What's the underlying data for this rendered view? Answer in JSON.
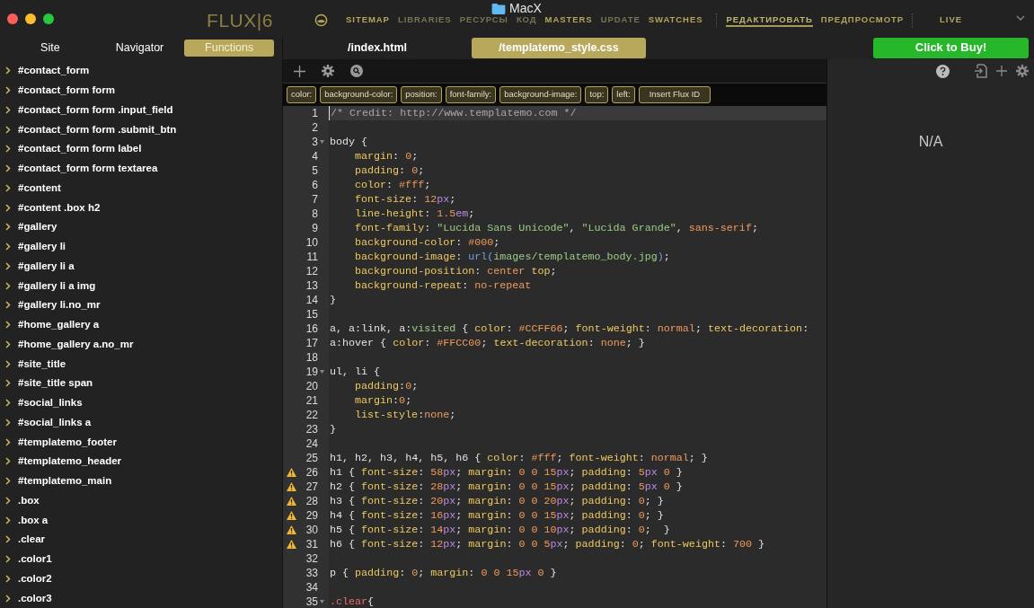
{
  "window": {
    "title": "MacX"
  },
  "logo": "FLUX|6",
  "nav": [
    {
      "label": "SITEMAP",
      "selected": false,
      "dim": false
    },
    {
      "label": "LIBRARIES",
      "selected": false,
      "dim": true
    },
    {
      "label": "РЕСУРСЫ",
      "selected": false,
      "dim": true
    },
    {
      "label": "КОД",
      "selected": false,
      "dim": true
    },
    {
      "label": "MASTERS",
      "selected": false,
      "dim": false
    },
    {
      "label": "UPDATE",
      "selected": false,
      "dim": true
    },
    {
      "label": "SWATCHES",
      "selected": false,
      "dim": false
    },
    {
      "label": "РЕДАКТИРОВАТЬ",
      "selected": true,
      "dim": false
    },
    {
      "label": "ПРЕДПРОСМОТР",
      "selected": false,
      "dim": false
    },
    {
      "label": "LIVE",
      "selected": false,
      "dim": false
    }
  ],
  "sidebar_tabs": [
    {
      "label": "Site",
      "selected": false
    },
    {
      "label": "Navigator",
      "selected": false
    },
    {
      "label": "Functions",
      "selected": true
    }
  ],
  "file_tabs": [
    {
      "label": "/index.html",
      "selected": false
    },
    {
      "label": "/templatemo_style.css",
      "selected": true
    }
  ],
  "buy_button": "Click to Buy!",
  "sidebar": {
    "items": [
      "#contact_form",
      "#contact_form form",
      "#contact_form form .input_field",
      "#contact_form form .submit_btn",
      "#contact_form form label",
      "#contact_form form textarea",
      "#content",
      "#content .box h2",
      "#gallery",
      "#gallery li",
      "#gallery li a",
      "#gallery li a img",
      "#gallery li.no_mr",
      "#home_gallery a",
      "#home_gallery a.no_mr",
      "#site_title",
      "#site_title span",
      "#social_links",
      "#social_links a",
      "#templatemo_footer",
      "#templatemo_header",
      "#templatemo_main",
      ".box",
      ".box a",
      ".clear",
      ".color1",
      ".color2",
      ".color3"
    ]
  },
  "chips": [
    "color:",
    "background-color:",
    "position:",
    "font-family:",
    "background-image:",
    "top:",
    "left:",
    "Insert Flux ID"
  ],
  "code_lines": [
    {
      "n": "1",
      "selected": true,
      "warning": false,
      "fold": false,
      "indent": false,
      "tokens": [
        {
          "kind": "comment",
          "text": "/* Credit: http://www.templatemo.com */"
        }
      ]
    },
    {
      "n": "2",
      "selected": false,
      "warning": false,
      "fold": false
    },
    {
      "n": "3",
      "selected": false,
      "warning": false,
      "fold": true,
      "indent": false,
      "tokens": [
        {
          "kind": "selector",
          "text": "body"
        },
        {
          "kind": "plain",
          "text": " {"
        }
      ]
    },
    {
      "n": "4",
      "selected": false,
      "warning": false,
      "fold": false,
      "indent": true,
      "tokens": [
        {
          "kind": "prop",
          "text": "margin"
        },
        {
          "kind": "plain",
          "text": ": "
        },
        {
          "kind": "num",
          "text": "0"
        },
        {
          "kind": "plain",
          "text": ";"
        }
      ]
    },
    {
      "n": "5",
      "selected": false,
      "warning": false,
      "fold": false,
      "indent": true,
      "tokens": [
        {
          "kind": "prop",
          "text": "padding"
        },
        {
          "kind": "plain",
          "text": ": "
        },
        {
          "kind": "num",
          "text": "0"
        },
        {
          "kind": "plain",
          "text": ";"
        }
      ]
    },
    {
      "n": "6",
      "selected": false,
      "warning": false,
      "fold": false,
      "indent": true,
      "tokens": [
        {
          "kind": "prop",
          "text": "color"
        },
        {
          "kind": "plain",
          "text": ": "
        },
        {
          "kind": "num",
          "text": "#fff"
        },
        {
          "kind": "plain",
          "text": ";"
        }
      ]
    },
    {
      "n": "7",
      "selected": false,
      "warning": false,
      "fold": false,
      "indent": true,
      "tokens": [
        {
          "kind": "prop",
          "text": "font-size"
        },
        {
          "kind": "plain",
          "text": ": "
        },
        {
          "kind": "num",
          "text": "12"
        },
        {
          "kind": "unit",
          "text": "px"
        },
        {
          "kind": "plain",
          "text": ";"
        }
      ]
    },
    {
      "n": "8",
      "selected": false,
      "warning": false,
      "fold": false,
      "indent": true,
      "tokens": [
        {
          "kind": "prop",
          "text": "line-height"
        },
        {
          "kind": "plain",
          "text": ": "
        },
        {
          "kind": "num",
          "text": "1.5"
        },
        {
          "kind": "unit",
          "text": "em"
        },
        {
          "kind": "plain",
          "text": ";"
        }
      ]
    },
    {
      "n": "9",
      "selected": false,
      "warning": false,
      "fold": false,
      "indent": true,
      "tokens": [
        {
          "kind": "prop",
          "text": "font-family"
        },
        {
          "kind": "plain",
          "text": ": "
        },
        {
          "kind": "string",
          "text": "\"Lucida Sans Unicode\""
        },
        {
          "kind": "plain",
          "text": ", "
        },
        {
          "kind": "string",
          "text": "\"Lucida Grande\""
        },
        {
          "kind": "plain",
          "text": ", "
        },
        {
          "kind": "keyword",
          "text": "sans-serif"
        },
        {
          "kind": "plain",
          "text": ";"
        }
      ]
    },
    {
      "n": "10",
      "selected": false,
      "warning": false,
      "fold": false,
      "indent": true,
      "tokens": [
        {
          "kind": "prop",
          "text": "background-color"
        },
        {
          "kind": "plain",
          "text": ": "
        },
        {
          "kind": "num",
          "text": "#000"
        },
        {
          "kind": "plain",
          "text": ";"
        }
      ]
    },
    {
      "n": "11",
      "selected": false,
      "warning": false,
      "fold": false,
      "indent": true,
      "tokens": [
        {
          "kind": "prop",
          "text": "background-image"
        },
        {
          "kind": "plain",
          "text": ": "
        },
        {
          "kind": "func",
          "text": "url("
        },
        {
          "kind": "string",
          "text": "images/templatemo_body.jpg"
        },
        {
          "kind": "func",
          "text": ")"
        },
        {
          "kind": "plain",
          "text": ";"
        }
      ]
    },
    {
      "n": "12",
      "selected": false,
      "warning": false,
      "fold": false,
      "indent": true,
      "tokens": [
        {
          "kind": "prop",
          "text": "background-position"
        },
        {
          "kind": "plain",
          "text": ": "
        },
        {
          "kind": "keyword",
          "text": "center"
        },
        {
          "kind": "prop",
          "text": " top"
        },
        {
          "kind": "plain",
          "text": ";"
        }
      ]
    },
    {
      "n": "13",
      "selected": false,
      "warning": false,
      "fold": false,
      "indent": true,
      "tokens": [
        {
          "kind": "prop",
          "text": "background-repeat"
        },
        {
          "kind": "plain",
          "text": ": "
        },
        {
          "kind": "keyword",
          "text": "no-repeat"
        }
      ]
    },
    {
      "n": "14",
      "selected": false,
      "warning": false,
      "fold": false,
      "indent": false,
      "tokens": [
        {
          "kind": "plain",
          "text": "}"
        }
      ]
    },
    {
      "n": "15",
      "selected": false,
      "warning": false,
      "fold": false
    },
    {
      "n": "16",
      "selected": false,
      "warning": false,
      "fold": false,
      "indent": false,
      "tokens": [
        {
          "kind": "selector",
          "text": "a, a:link, a:"
        },
        {
          "kind": "pseudo",
          "text": "visited"
        },
        {
          "kind": "plain",
          "text": " { "
        },
        {
          "kind": "prop",
          "text": "color"
        },
        {
          "kind": "plain",
          "text": ": "
        },
        {
          "kind": "num",
          "text": "#CCFF66"
        },
        {
          "kind": "plain",
          "text": "; "
        },
        {
          "kind": "prop",
          "text": "font-weight"
        },
        {
          "kind": "plain",
          "text": ": "
        },
        {
          "kind": "keyword",
          "text": "normal"
        },
        {
          "kind": "plain",
          "text": "; "
        },
        {
          "kind": "prop",
          "text": "text-decoration"
        },
        {
          "kind": "plain",
          "text": ":"
        }
      ]
    },
    {
      "n": "17",
      "selected": false,
      "warning": false,
      "fold": false,
      "indent": false,
      "tokens": [
        {
          "kind": "selector",
          "text": "a:hover"
        },
        {
          "kind": "plain",
          "text": " { "
        },
        {
          "kind": "prop",
          "text": "color"
        },
        {
          "kind": "plain",
          "text": ": "
        },
        {
          "kind": "num",
          "text": "#FFCC00"
        },
        {
          "kind": "plain",
          "text": "; "
        },
        {
          "kind": "prop",
          "text": "text-decoration"
        },
        {
          "kind": "plain",
          "text": ": "
        },
        {
          "kind": "keyword",
          "text": "none"
        },
        {
          "kind": "plain",
          "text": "; }"
        }
      ]
    },
    {
      "n": "18",
      "selected": false,
      "warning": false,
      "fold": false
    },
    {
      "n": "19",
      "selected": false,
      "warning": false,
      "fold": true,
      "indent": false,
      "tokens": [
        {
          "kind": "selector",
          "text": "ul, li"
        },
        {
          "kind": "plain",
          "text": " {"
        }
      ]
    },
    {
      "n": "20",
      "selected": false,
      "warning": false,
      "fold": false,
      "indent": true,
      "tokens": [
        {
          "kind": "prop",
          "text": "padding"
        },
        {
          "kind": "plain",
          "text": ":"
        },
        {
          "kind": "num",
          "text": "0"
        },
        {
          "kind": "plain",
          "text": ";"
        }
      ]
    },
    {
      "n": "21",
      "selected": false,
      "warning": false,
      "fold": false,
      "indent": true,
      "tokens": [
        {
          "kind": "prop",
          "text": "margin"
        },
        {
          "kind": "plain",
          "text": ":"
        },
        {
          "kind": "num",
          "text": "0"
        },
        {
          "kind": "plain",
          "text": ";"
        }
      ]
    },
    {
      "n": "22",
      "selected": false,
      "warning": false,
      "fold": false,
      "indent": true,
      "tokens": [
        {
          "kind": "prop",
          "text": "list-style"
        },
        {
          "kind": "plain",
          "text": ":"
        },
        {
          "kind": "keyword",
          "text": "none"
        },
        {
          "kind": "plain",
          "text": ";"
        }
      ]
    },
    {
      "n": "23",
      "selected": false,
      "warning": false,
      "fold": false,
      "indent": false,
      "tokens": [
        {
          "kind": "plain",
          "text": "}"
        }
      ]
    },
    {
      "n": "24",
      "selected": false,
      "warning": false,
      "fold": false
    },
    {
      "n": "25",
      "selected": false,
      "warning": false,
      "fold": false,
      "indent": false,
      "tokens": [
        {
          "kind": "selector",
          "text": "h1, h2, h3, h4, h5, h6"
        },
        {
          "kind": "plain",
          "text": " { "
        },
        {
          "kind": "prop",
          "text": "color"
        },
        {
          "kind": "plain",
          "text": ": "
        },
        {
          "kind": "num",
          "text": "#fff"
        },
        {
          "kind": "plain",
          "text": "; "
        },
        {
          "kind": "prop",
          "text": "font-weight"
        },
        {
          "kind": "plain",
          "text": ": "
        },
        {
          "kind": "keyword",
          "text": "normal"
        },
        {
          "kind": "plain",
          "text": "; }"
        }
      ]
    },
    {
      "n": "26",
      "selected": false,
      "warning": true,
      "fold": false,
      "indent": false,
      "tokens": [
        {
          "kind": "selector",
          "text": "h1"
        },
        {
          "kind": "plain",
          "text": " { "
        },
        {
          "kind": "prop",
          "text": "font-size"
        },
        {
          "kind": "plain",
          "text": ": "
        },
        {
          "kind": "num",
          "text": "58"
        },
        {
          "kind": "unit",
          "text": "px"
        },
        {
          "kind": "plain",
          "text": "; "
        },
        {
          "kind": "prop",
          "text": "margin"
        },
        {
          "kind": "plain",
          "text": ": "
        },
        {
          "kind": "num",
          "text": "0 0 15"
        },
        {
          "kind": "unit",
          "text": "px"
        },
        {
          "kind": "plain",
          "text": "; "
        },
        {
          "kind": "prop",
          "text": "padding"
        },
        {
          "kind": "plain",
          "text": ": "
        },
        {
          "kind": "num",
          "text": "5"
        },
        {
          "kind": "unit",
          "text": "px"
        },
        {
          "kind": "num",
          "text": " 0"
        },
        {
          "kind": "plain",
          "text": " }"
        }
      ]
    },
    {
      "n": "27",
      "selected": false,
      "warning": true,
      "fold": false,
      "indent": false,
      "tokens": [
        {
          "kind": "selector",
          "text": "h2"
        },
        {
          "kind": "plain",
          "text": " { "
        },
        {
          "kind": "prop",
          "text": "font-size"
        },
        {
          "kind": "plain",
          "text": ": "
        },
        {
          "kind": "num",
          "text": "28"
        },
        {
          "kind": "unit",
          "text": "px"
        },
        {
          "kind": "plain",
          "text": "; "
        },
        {
          "kind": "prop",
          "text": "margin"
        },
        {
          "kind": "plain",
          "text": ": "
        },
        {
          "kind": "num",
          "text": "0 0 15"
        },
        {
          "kind": "unit",
          "text": "px"
        },
        {
          "kind": "plain",
          "text": "; "
        },
        {
          "kind": "prop",
          "text": "padding"
        },
        {
          "kind": "plain",
          "text": ": "
        },
        {
          "kind": "num",
          "text": "5"
        },
        {
          "kind": "unit",
          "text": "px"
        },
        {
          "kind": "num",
          "text": " 0"
        },
        {
          "kind": "plain",
          "text": " }"
        }
      ]
    },
    {
      "n": "28",
      "selected": false,
      "warning": true,
      "fold": false,
      "indent": false,
      "tokens": [
        {
          "kind": "selector",
          "text": "h3"
        },
        {
          "kind": "plain",
          "text": " { "
        },
        {
          "kind": "prop",
          "text": "font-size"
        },
        {
          "kind": "plain",
          "text": ": "
        },
        {
          "kind": "num",
          "text": "20"
        },
        {
          "kind": "unit",
          "text": "px"
        },
        {
          "kind": "plain",
          "text": "; "
        },
        {
          "kind": "prop",
          "text": "margin"
        },
        {
          "kind": "plain",
          "text": ": "
        },
        {
          "kind": "num",
          "text": "0 0 20"
        },
        {
          "kind": "unit",
          "text": "px"
        },
        {
          "kind": "plain",
          "text": "; "
        },
        {
          "kind": "prop",
          "text": "padding"
        },
        {
          "kind": "plain",
          "text": ": "
        },
        {
          "kind": "num",
          "text": "0"
        },
        {
          "kind": "plain",
          "text": "; }"
        }
      ]
    },
    {
      "n": "29",
      "selected": false,
      "warning": true,
      "fold": false,
      "indent": false,
      "tokens": [
        {
          "kind": "selector",
          "text": "h4"
        },
        {
          "kind": "plain",
          "text": " { "
        },
        {
          "kind": "prop",
          "text": "font-size"
        },
        {
          "kind": "plain",
          "text": ": "
        },
        {
          "kind": "num",
          "text": "16"
        },
        {
          "kind": "unit",
          "text": "px"
        },
        {
          "kind": "plain",
          "text": "; "
        },
        {
          "kind": "prop",
          "text": "margin"
        },
        {
          "kind": "plain",
          "text": ": "
        },
        {
          "kind": "num",
          "text": "0 0 15"
        },
        {
          "kind": "unit",
          "text": "px"
        },
        {
          "kind": "plain",
          "text": "; "
        },
        {
          "kind": "prop",
          "text": "padding"
        },
        {
          "kind": "plain",
          "text": ": "
        },
        {
          "kind": "num",
          "text": "0"
        },
        {
          "kind": "plain",
          "text": "; }"
        }
      ]
    },
    {
      "n": "30",
      "selected": false,
      "warning": true,
      "fold": false,
      "indent": false,
      "tokens": [
        {
          "kind": "selector",
          "text": "h5"
        },
        {
          "kind": "plain",
          "text": " { "
        },
        {
          "kind": "prop",
          "text": "font-size"
        },
        {
          "kind": "plain",
          "text": ": "
        },
        {
          "kind": "num",
          "text": "14"
        },
        {
          "kind": "unit",
          "text": "px"
        },
        {
          "kind": "plain",
          "text": "; "
        },
        {
          "kind": "prop",
          "text": "margin"
        },
        {
          "kind": "plain",
          "text": ": "
        },
        {
          "kind": "num",
          "text": "0 0 10"
        },
        {
          "kind": "unit",
          "text": "px"
        },
        {
          "kind": "plain",
          "text": "; "
        },
        {
          "kind": "prop",
          "text": "padding"
        },
        {
          "kind": "plain",
          "text": ": "
        },
        {
          "kind": "num",
          "text": "0"
        },
        {
          "kind": "plain",
          "text": ";  }"
        }
      ]
    },
    {
      "n": "31",
      "selected": false,
      "warning": true,
      "fold": false,
      "indent": false,
      "tokens": [
        {
          "kind": "selector",
          "text": "h6"
        },
        {
          "kind": "plain",
          "text": " { "
        },
        {
          "kind": "prop",
          "text": "font-size"
        },
        {
          "kind": "plain",
          "text": ": "
        },
        {
          "kind": "num",
          "text": "12"
        },
        {
          "kind": "unit",
          "text": "px"
        },
        {
          "kind": "plain",
          "text": "; "
        },
        {
          "kind": "prop",
          "text": "margin"
        },
        {
          "kind": "plain",
          "text": ": "
        },
        {
          "kind": "num",
          "text": "0 0 5"
        },
        {
          "kind": "unit",
          "text": "px"
        },
        {
          "kind": "plain",
          "text": "; "
        },
        {
          "kind": "prop",
          "text": "padding"
        },
        {
          "kind": "plain",
          "text": ": "
        },
        {
          "kind": "num",
          "text": "0"
        },
        {
          "kind": "plain",
          "text": "; "
        },
        {
          "kind": "prop",
          "text": "font-weight"
        },
        {
          "kind": "plain",
          "text": ": "
        },
        {
          "kind": "num",
          "text": "700"
        },
        {
          "kind": "plain",
          "text": " }"
        }
      ]
    },
    {
      "n": "32",
      "selected": false,
      "warning": false,
      "fold": false
    },
    {
      "n": "33",
      "selected": false,
      "warning": false,
      "fold": false,
      "indent": false,
      "tokens": [
        {
          "kind": "selector",
          "text": "p"
        },
        {
          "kind": "plain",
          "text": " { "
        },
        {
          "kind": "prop",
          "text": "padding"
        },
        {
          "kind": "plain",
          "text": ": "
        },
        {
          "kind": "num",
          "text": "0"
        },
        {
          "kind": "plain",
          "text": "; "
        },
        {
          "kind": "prop",
          "text": "margin"
        },
        {
          "kind": "plain",
          "text": ": "
        },
        {
          "kind": "num",
          "text": "0 0 15"
        },
        {
          "kind": "unit",
          "text": "px"
        },
        {
          "kind": "num",
          "text": " 0"
        },
        {
          "kind": "plain",
          "text": " }"
        }
      ]
    },
    {
      "n": "34",
      "selected": false,
      "warning": false,
      "fold": false
    },
    {
      "n": "35",
      "selected": false,
      "warning": false,
      "fold": true,
      "indent": false,
      "tokens": [
        {
          "kind": "class",
          "text": ".clear"
        },
        {
          "kind": "plain",
          "text": "{"
        }
      ]
    }
  ],
  "inspector": {
    "value": "N/A"
  }
}
